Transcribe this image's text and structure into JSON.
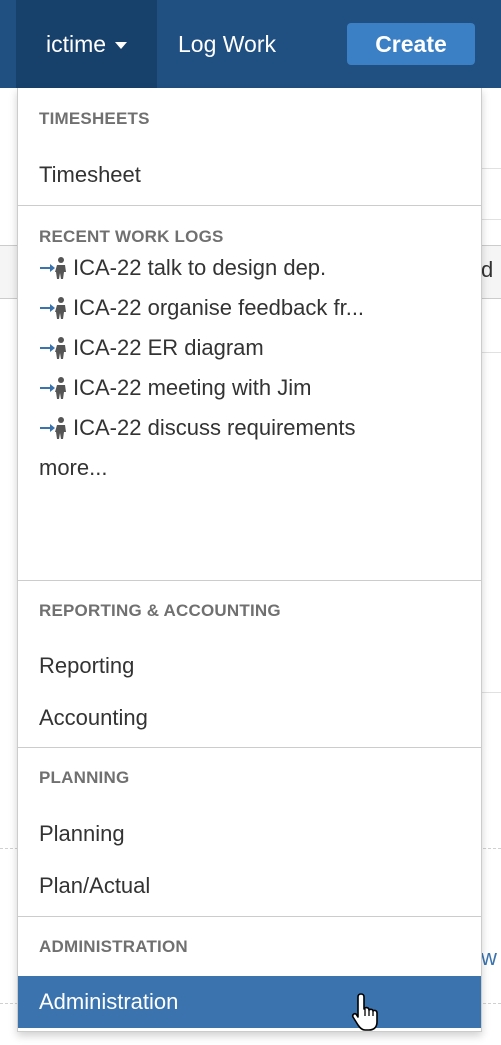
{
  "nav": {
    "app_menu_label": "ictime",
    "log_work_label": "Log Work",
    "create_label": "Create"
  },
  "menu": {
    "sections": [
      {
        "header": "TIMESHEETS",
        "items": [
          "Timesheet"
        ]
      },
      {
        "header": "RECENT WORK LOGS",
        "items": [
          "ICA-22 talk to design dep.",
          "ICA-22 organise feedback fr...",
          "ICA-22 ER diagram",
          "ICA-22 meeting with Jim",
          "ICA-22 discuss requirements"
        ],
        "more_label": "more..."
      },
      {
        "header": "REPORTING & ACCOUNTING",
        "items": [
          "Reporting",
          "Accounting"
        ]
      },
      {
        "header": "PLANNING",
        "items": [
          "Planning",
          "Plan/Actual"
        ]
      },
      {
        "header": "ADMINISTRATION",
        "items": [
          "Administration"
        ]
      }
    ],
    "hovered_item": "Administration"
  },
  "background": {
    "text_fragment_1": "d",
    "text_fragment_2": "w"
  },
  "icons": {
    "work_log": "arrow-person-icon",
    "caret": "chevron-down-icon",
    "cursor": "hand-pointer-icon"
  },
  "colors": {
    "topbar": "#205081",
    "topbar_active": "#17406b",
    "create_button": "#3b7fc4",
    "menu_hover": "#3b73af",
    "header_text": "#707070"
  }
}
